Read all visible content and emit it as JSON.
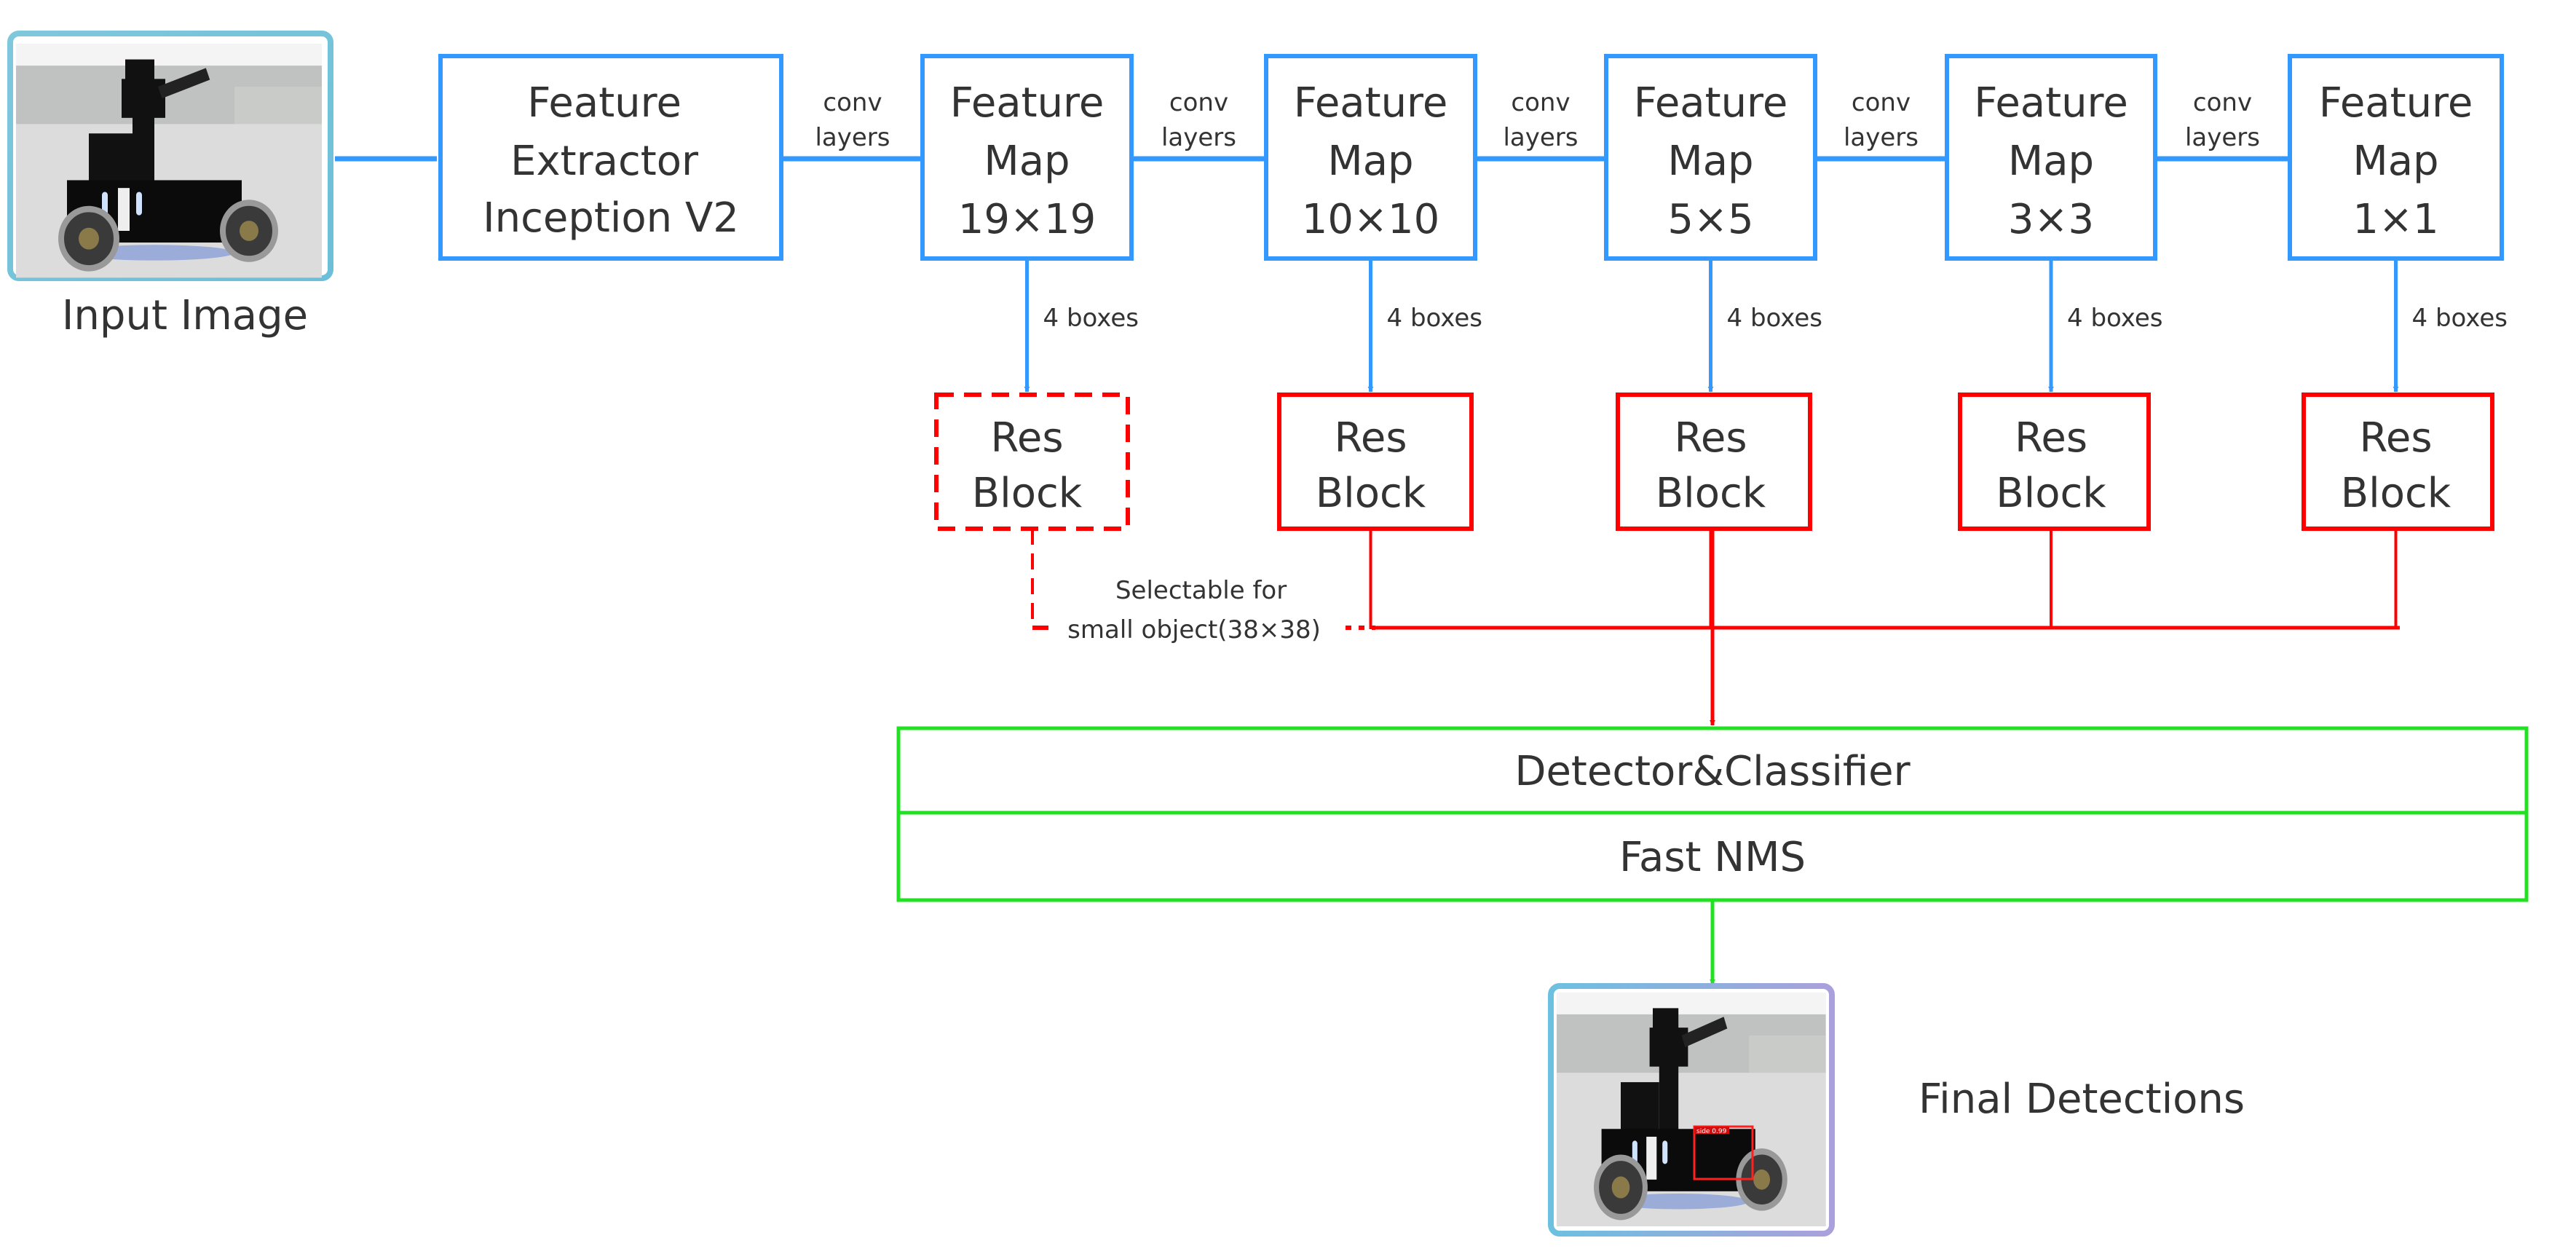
{
  "colors": {
    "feature": "#3399ff",
    "res": "#ff0000",
    "detector": "#22e022",
    "text": "#333333"
  },
  "input": {
    "label": "Input Image"
  },
  "extractor": {
    "lines": [
      "Feature",
      "Extractor",
      "Inception V2"
    ]
  },
  "edge_label": {
    "line1": "conv",
    "line2": "layers"
  },
  "boxes_label": "4 boxes",
  "feature_maps": [
    {
      "lines": [
        "Feature",
        "Map",
        "19×19"
      ]
    },
    {
      "lines": [
        "Feature",
        "Map",
        "10×10"
      ]
    },
    {
      "lines": [
        "Feature",
        "Map",
        "5×5"
      ]
    },
    {
      "lines": [
        "Feature",
        "Map",
        "3×3"
      ]
    },
    {
      "lines": [
        "Feature",
        "Map",
        "1×1"
      ]
    }
  ],
  "res_block": {
    "line1": "Res",
    "line2": "Block"
  },
  "selectable_note": {
    "line1": "Selectable for",
    "line2": "small object(38×38)"
  },
  "detector": {
    "row1": "Detector&Classifier",
    "row2": "Fast NMS"
  },
  "output": {
    "label": "Final Detections",
    "detection_label": "side 0.99"
  }
}
